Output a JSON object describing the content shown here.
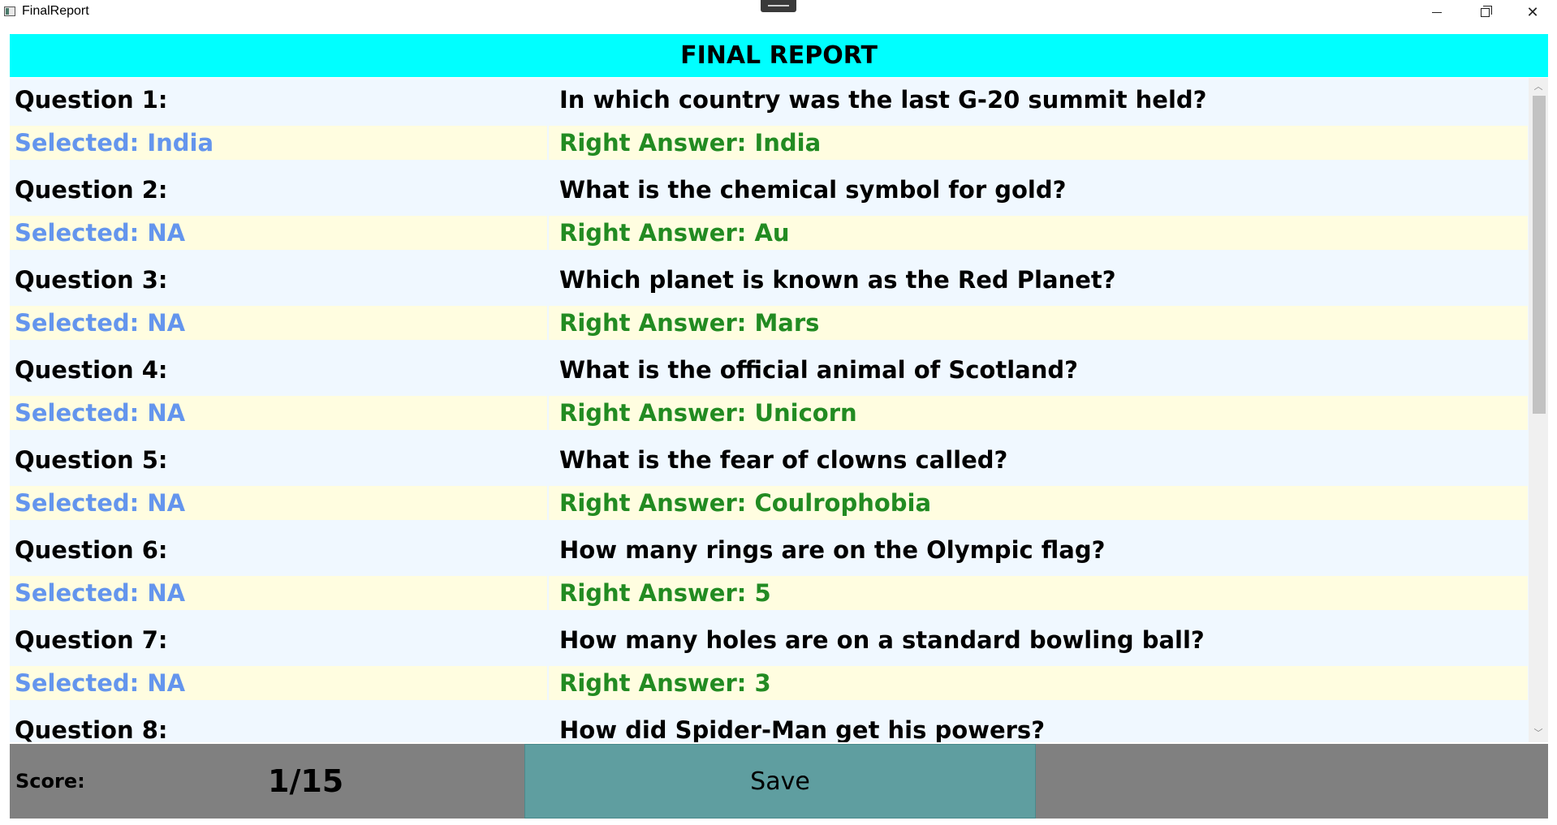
{
  "window": {
    "title": "FinalReport",
    "icons": [
      "app-icon",
      "minimize-icon",
      "restore-icon",
      "close-icon"
    ],
    "close_glyph": "✕"
  },
  "header": {
    "title": "FINAL REPORT",
    "background": "#00ffff"
  },
  "colors": {
    "list_background": "#f0f8ff",
    "answer_row_background": "#fffde0",
    "selected_text": "#6495ed",
    "right_answer_text": "#228b22",
    "footer_background": "#808080",
    "save_button_background": "#5f9ea0"
  },
  "questions": [
    {
      "label": "Question 1:",
      "text": "In which country was the last G-20 summit held?",
      "selected": "Selected: India",
      "right_answer": "Right Answer: India"
    },
    {
      "label": "Question 2:",
      "text": "What is the chemical symbol for gold?",
      "selected": "Selected: NA",
      "right_answer": "Right Answer: Au"
    },
    {
      "label": "Question 3:",
      "text": "Which planet is known as the Red Planet?",
      "selected": "Selected: NA",
      "right_answer": "Right Answer: Mars"
    },
    {
      "label": "Question 4:",
      "text": "What is the official animal of Scotland?",
      "selected": "Selected: NA",
      "right_answer": "Right Answer: Unicorn"
    },
    {
      "label": "Question 5:",
      "text": "What is the fear of clowns called?",
      "selected": "Selected: NA",
      "right_answer": "Right Answer: Coulrophobia"
    },
    {
      "label": "Question 6:",
      "text": "How many rings are on the Olympic flag?",
      "selected": "Selected: NA",
      "right_answer": "Right Answer: 5"
    },
    {
      "label": "Question 7:",
      "text": "How many holes are on a standard bowling ball?",
      "selected": "Selected: NA",
      "right_answer": "Right Answer: 3"
    },
    {
      "label": "Question 8:",
      "text": "How did Spider-Man get his powers?"
    }
  ],
  "scrollbar": {
    "up_glyph": "︿",
    "down_glyph": "﹀"
  },
  "footer": {
    "score_label": "Score:",
    "score_value": "1/15",
    "save_label": "Save"
  }
}
